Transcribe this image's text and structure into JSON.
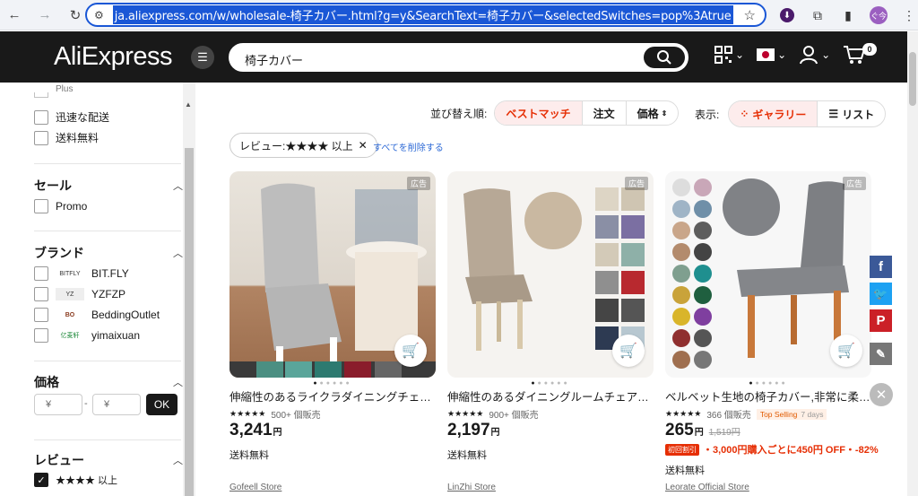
{
  "browser": {
    "url": "ja.aliexpress.com/w/wholesale-椅子カバー.html?g=y&SearchText=椅子カバー&selectedSwitches=pop%3Atrue",
    "avatar_text": "ぐ今"
  },
  "header": {
    "logo": "AliExpress",
    "search_value": "椅子カバー",
    "cart_count": "0"
  },
  "sidebar": {
    "top_items": [
      {
        "label": "Plus"
      },
      {
        "label": "迅速な配送"
      },
      {
        "label": "送料無料"
      }
    ],
    "sale": {
      "title": "セール",
      "items": [
        {
          "label": "Promo"
        }
      ]
    },
    "brand": {
      "title": "ブランド",
      "items": [
        {
          "label": "BIT.FLY",
          "logo": "BITFLY"
        },
        {
          "label": "YZFZP",
          "logo": "YZ"
        },
        {
          "label": "BeddingOutlet",
          "logo": "BO"
        },
        {
          "label": "yimaixuan",
          "logo": "亿麦轩"
        }
      ]
    },
    "price": {
      "title": "価格",
      "min_placeholder": "¥",
      "max_placeholder": "¥",
      "separator": "-",
      "ok": "OK"
    },
    "review": {
      "title": "レビュー",
      "item": "★★★★ 以上"
    }
  },
  "sort": {
    "label": "並び替え順:",
    "options": [
      "ベストマッチ",
      "注文",
      "価格"
    ],
    "view_label": "表示:",
    "gallery": "ギャラリー",
    "list": "リスト"
  },
  "filter_chip": {
    "label": "レビュー:★★★★ 以上",
    "clear_all": "すべてを削除する"
  },
  "products": [
    {
      "ad": "広告",
      "title": "伸縮性のあるライクラダイニングチェアカバー",
      "stars": "★★★★★",
      "sold": "500+ 個販売",
      "price": "3,241",
      "yen": "円",
      "shipping": "送料無料",
      "store": "Gofeell Store"
    },
    {
      "ad": "広告",
      "title": "伸縮性のあるダイニングルームチェアカバー",
      "stars": "★★★★★",
      "sold": "900+ 個販売",
      "price": "2,197",
      "yen": "円",
      "shipping": "送料無料",
      "store": "LinZhi Store"
    },
    {
      "ad": "広告",
      "title": "ベルベット生地の椅子カバー,非常に柔らかい",
      "stars": "★★★★★",
      "sold": "366 個販売",
      "top_selling": "Top Selling",
      "top_days": "7 days",
      "price": "265",
      "yen": "円",
      "old_price": "1,519円",
      "promo_badge": "初回割引",
      "promo_text": "・3,000円購入ごとに450円 OFF・-82%",
      "shipping": "送料無料",
      "store": "Leorate Official Store"
    }
  ],
  "colors": {
    "brand_red": "#e62e04",
    "header_bg": "#191919",
    "link_blue": "#2e6ad6"
  }
}
